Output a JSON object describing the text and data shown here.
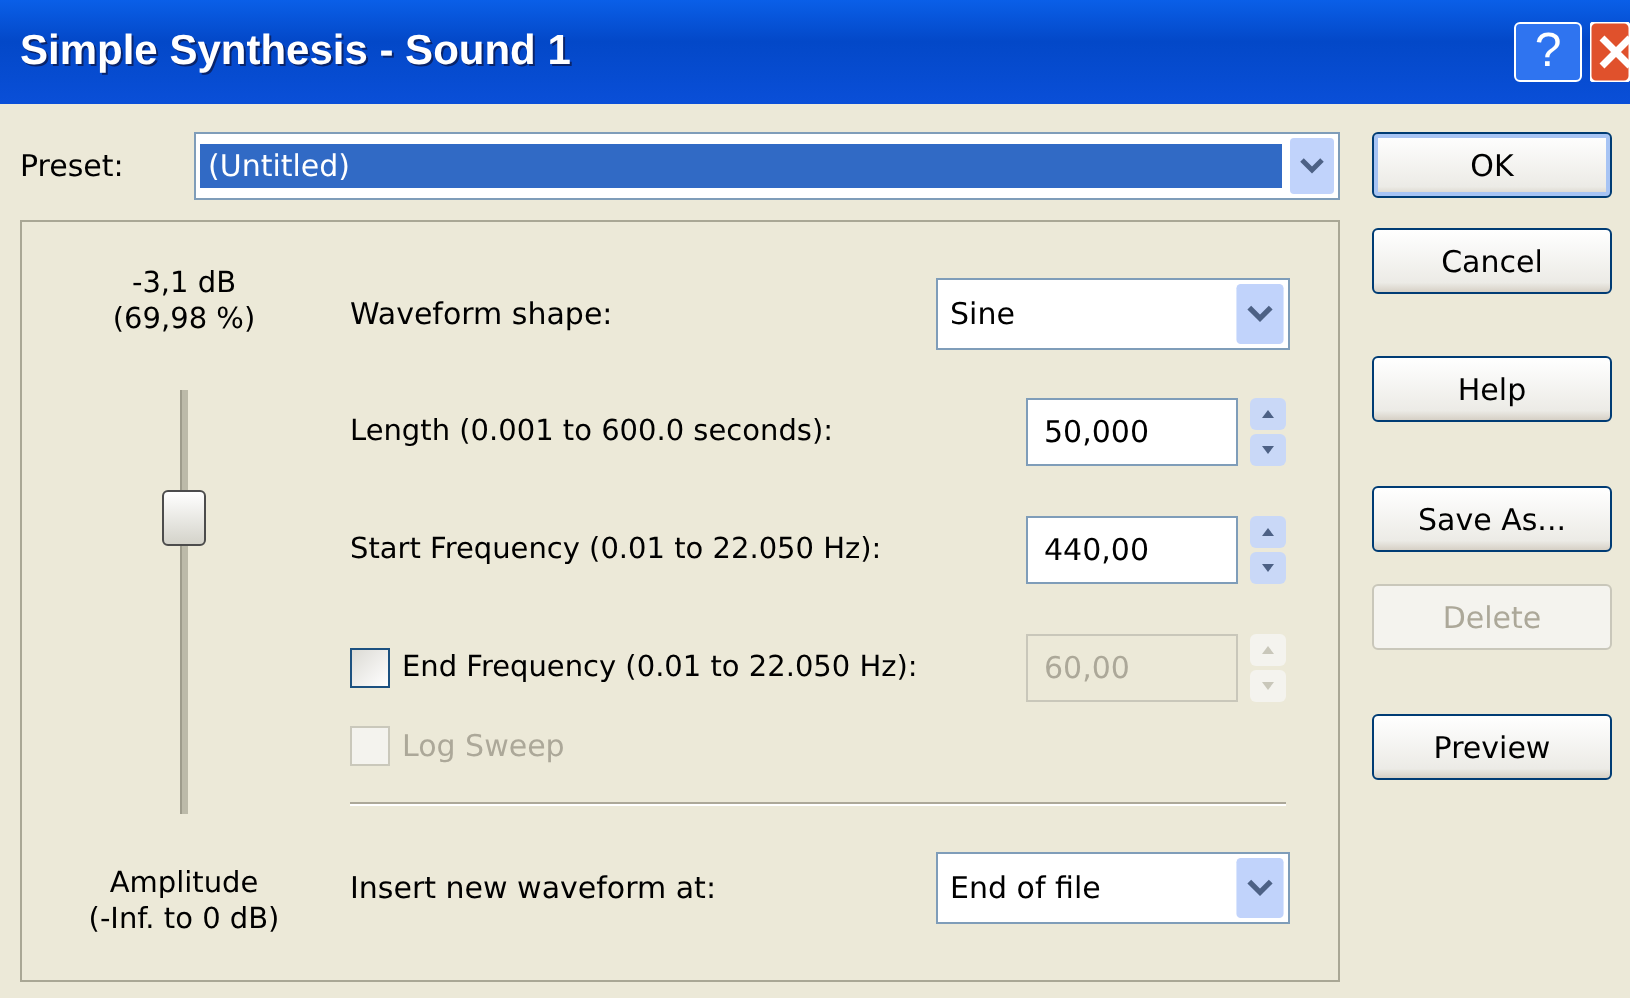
{
  "window": {
    "title": "Simple Synthesis - Sound 1",
    "help_button": "?"
  },
  "preset": {
    "label": "Preset:",
    "value": "(Untitled)",
    "selected": true
  },
  "amplitude": {
    "reading": "-3,1 dB",
    "percent": "(69,98 %)",
    "level": 0.7,
    "label": "Amplitude",
    "range": "(-Inf. to 0 dB)"
  },
  "rows": [
    {
      "kind": "select",
      "label": "Waveform shape:",
      "value": "Sine"
    },
    {
      "kind": "spin",
      "label": "Length (0.001 to 600.0 seconds):",
      "value": "50,000"
    },
    {
      "kind": "spin",
      "label": "Start Frequency (0.01 to 22.050 Hz):",
      "value": "440,00"
    },
    {
      "kind": "check-spin",
      "label": "End Frequency (0.01 to 22.050 Hz):",
      "value": "60,00",
      "checked": false
    },
    {
      "kind": "check",
      "label": "Log Sweep",
      "checked": false,
      "disabled": true
    },
    {
      "kind": "divider"
    },
    {
      "kind": "select",
      "label": "Insert new waveform at:",
      "value": "End of file"
    }
  ],
  "buttons": [
    {
      "label": "OK",
      "disabled": false,
      "default": true
    },
    {
      "label": "Cancel",
      "disabled": false,
      "default": false
    },
    {
      "label": "Help",
      "disabled": false,
      "default": false
    },
    {
      "label": "Save As...",
      "disabled": false,
      "default": false
    },
    {
      "label": "Delete",
      "disabled": true,
      "default": false
    },
    {
      "label": "Preview",
      "disabled": false,
      "default": false
    }
  ]
}
